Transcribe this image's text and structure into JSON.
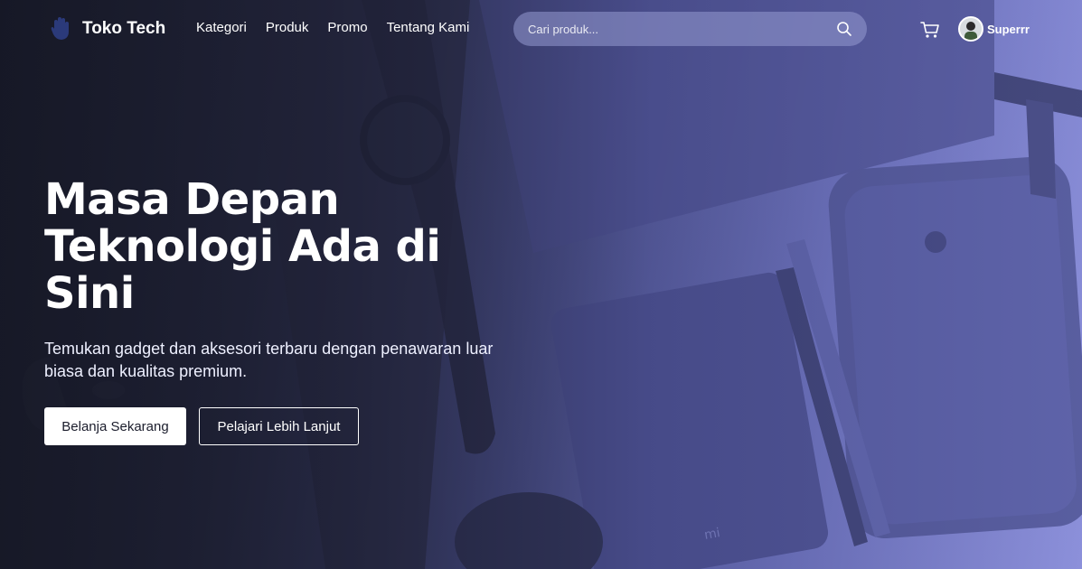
{
  "nav": {
    "brand": "Toko Tech",
    "links": [
      "Kategori",
      "Produk",
      "Promo",
      "Tentang Kami"
    ],
    "search_placeholder": "Cari produk...",
    "username": "Superrr"
  },
  "hero": {
    "headline": "Masa Depan Teknologi Ada di Sini",
    "subtext": "Temukan gadget dan aksesori terbaru dengan penawaran luar biasa dan kualitas premium.",
    "primary_button": "Belanja Sekarang",
    "secondary_button": "Pelajari Lebih Lanjut"
  },
  "icons": {
    "logo": "hand-logo-icon",
    "search": "search-icon",
    "cart": "cart-icon",
    "avatar": "user-avatar"
  },
  "colors": {
    "overlay_left": "#1b1d2c",
    "overlay_right": "#8c90da",
    "button_primary_bg": "#ffffff",
    "button_primary_text": "#1b1d2c"
  }
}
